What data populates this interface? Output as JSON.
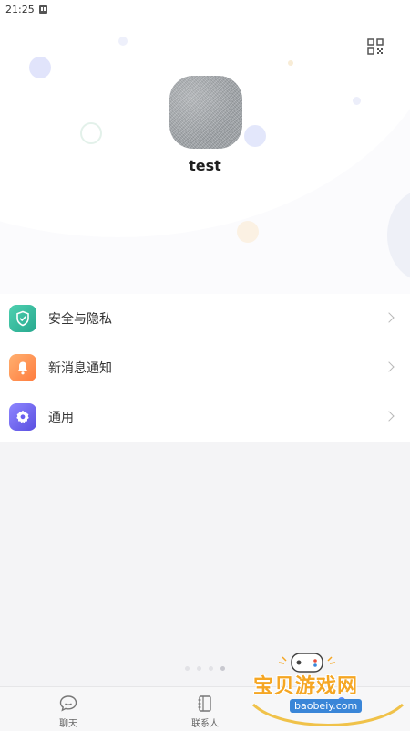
{
  "status_bar": {
    "time": "21:25",
    "notification_icon": "app-notification-icon"
  },
  "profile": {
    "qr_icon": "qr-code-icon",
    "avatar_alt": "user avatar",
    "username": "test"
  },
  "menu": {
    "items": [
      {
        "label": "安全与隐私",
        "icon": "shield-check-icon",
        "color": "#2fb596"
      },
      {
        "label": "新消息通知",
        "icon": "bell-icon",
        "color": "#ff8a48"
      },
      {
        "label": "通用",
        "icon": "gear-icon",
        "color": "#6a5ff0"
      }
    ]
  },
  "pager": {
    "count": 4,
    "active_index": 3
  },
  "tabbar": {
    "tabs": [
      {
        "label": "聊天",
        "icon": "chat-bubble-icon"
      },
      {
        "label": "联系人",
        "icon": "contacts-book-icon"
      },
      {
        "label": "",
        "icon": "profile-icon",
        "active": true
      }
    ]
  },
  "watermark": {
    "text": "宝贝游戏网",
    "url": "baobeiy.com"
  },
  "colors": {
    "accent": "#5a8cff",
    "background": "#f4f4f6"
  }
}
